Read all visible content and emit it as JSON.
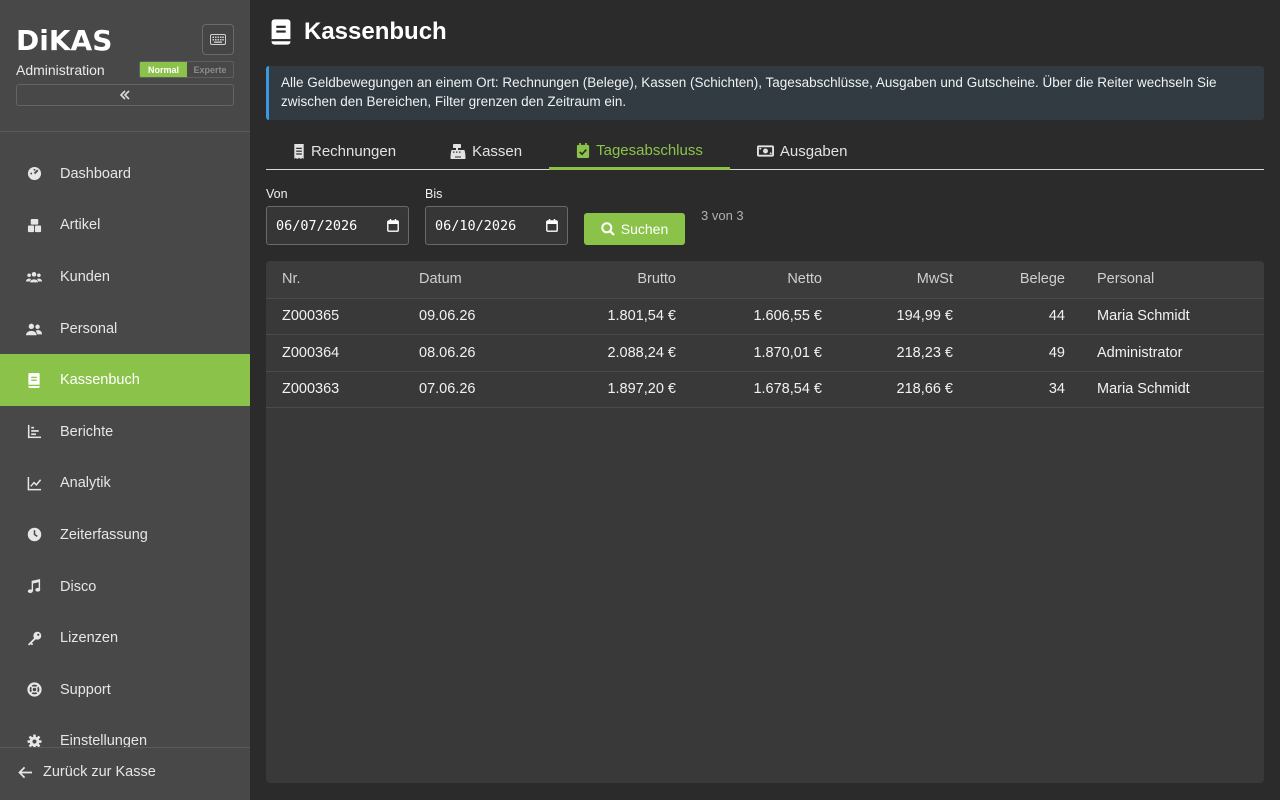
{
  "app": {
    "logo_text": "DiKAS",
    "subtitle": "Administration",
    "mode_normal": "Normal",
    "mode_expert": "Experte",
    "accent": "#8bc34a"
  },
  "nav": [
    {
      "label": "Dashboard",
      "icon": "dashboard-icon"
    },
    {
      "label": "Artikel",
      "icon": "boxes-icon"
    },
    {
      "label": "Kunden",
      "icon": "users-icon"
    },
    {
      "label": "Personal",
      "icon": "staff-icon"
    },
    {
      "label": "Kassenbuch",
      "icon": "book-icon",
      "active": true
    },
    {
      "label": "Berichte",
      "icon": "bar-chart-icon"
    },
    {
      "label": "Analytik",
      "icon": "line-chart-icon"
    },
    {
      "label": "Zeiterfassung",
      "icon": "clock-icon"
    },
    {
      "label": "Disco",
      "icon": "music-icon"
    },
    {
      "label": "Lizenzen",
      "icon": "key-icon"
    },
    {
      "label": "Support",
      "icon": "lifebuoy-icon"
    },
    {
      "label": "Einstellungen",
      "icon": "gear-icon"
    }
  ],
  "back_label": "Zurück zur Kasse",
  "page": {
    "title": "Kassenbuch",
    "info": "Alle Geldbewegungen an einem Ort: Rechnungen (Belege), Kassen (Schichten), Tagesabschlüsse, Ausgaben und Gutscheine. Über die Reiter wechseln Sie zwischen den Bereichen, Filter grenzen den Zeitraum ein."
  },
  "tabs": [
    {
      "label": "Rechnungen",
      "icon": "receipt-icon"
    },
    {
      "label": "Kassen",
      "icon": "cash-register-icon"
    },
    {
      "label": "Tagesabschluss",
      "icon": "calendar-check-icon",
      "active": true
    },
    {
      "label": "Ausgaben",
      "icon": "money-bill-icon"
    }
  ],
  "filter": {
    "from_label": "Von",
    "from_value": "06/07/2026",
    "to_label": "Bis",
    "to_value": "06/10/2026",
    "search_label": "Suchen",
    "count": "3 von 3"
  },
  "table": {
    "headers": {
      "nr": "Nr.",
      "datum": "Datum",
      "brutto": "Brutto",
      "netto": "Netto",
      "mwst": "MwSt",
      "belege": "Belege",
      "personal": "Personal"
    },
    "rows": [
      {
        "nr": "Z000365",
        "datum": "09.06.26",
        "brutto": "1.801,54 €",
        "netto": "1.606,55 €",
        "mwst": "194,99 €",
        "belege": "44",
        "personal": "Maria Schmidt"
      },
      {
        "nr": "Z000364",
        "datum": "08.06.26",
        "brutto": "2.088,24 €",
        "netto": "1.870,01 €",
        "mwst": "218,23 €",
        "belege": "49",
        "personal": "Administrator"
      },
      {
        "nr": "Z000363",
        "datum": "07.06.26",
        "brutto": "1.897,20 €",
        "netto": "1.678,54 €",
        "mwst": "218,66 €",
        "belege": "34",
        "personal": "Maria Schmidt"
      }
    ]
  }
}
